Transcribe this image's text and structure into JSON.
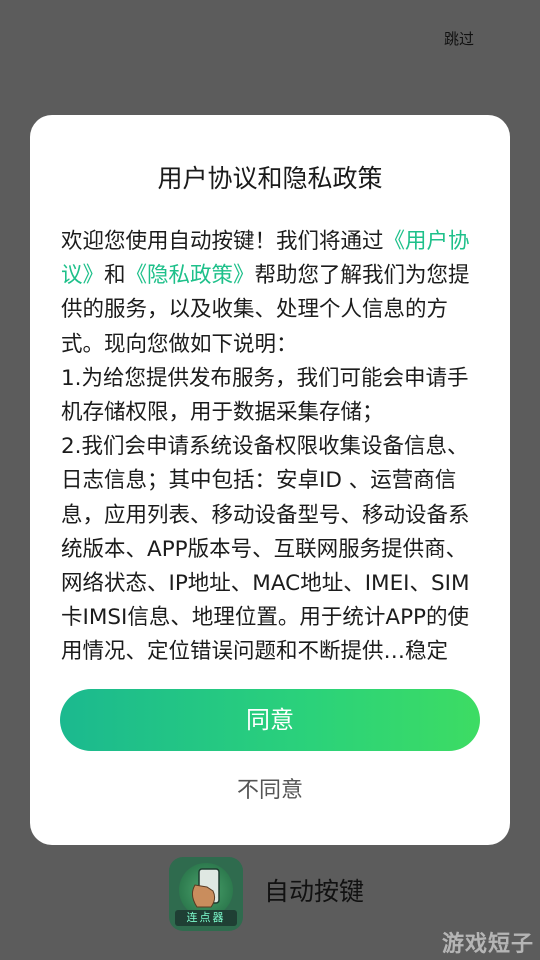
{
  "skip_label": "跳过",
  "dialog": {
    "title": "用户协议和隐私政策",
    "body": {
      "p1_before": "欢迎您使用自动按键！我们将通过",
      "link_agreement": "《用户协议》",
      "p1_and": "和",
      "link_privacy": "《隐私政策》",
      "p1_after": "帮助您了解我们为您提供的服务，以及收集、处理个人信息的方式。现向您做如下说明：",
      "item1": "1.为给您提供发布服务，我们可能会申请手机存储权限，用于数据采集存储；",
      "item2": "2.我们会申请系统设备权限收集设备信息、日志信息；其中包括：安卓ID 、运营商信息，应用列表、移动设备型号、移动设备系统版本、APP版本号、互联网服务提供商、网络状态、IP地址、MAC地址、IMEI、SIM卡IMSI信息、地理位置。用于统计APP的使用情况、定位错误问题和不断提供…稳定性、安全性"
    },
    "agree_label": "同意",
    "disagree_label": "不同意"
  },
  "app": {
    "name": "自动按键",
    "icon_badge": "连点器",
    "icon": "auto-clicker-app-icon"
  },
  "watermark": "游戏短子",
  "colors": {
    "link": "#1ec08a",
    "agree_gradient_start": "#1bb98f",
    "agree_gradient_end": "#3ddc63",
    "overlay": "#5c5c5c"
  }
}
